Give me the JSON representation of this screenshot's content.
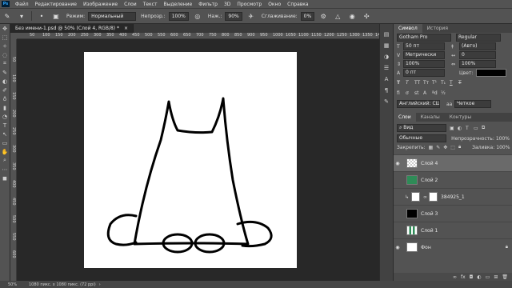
{
  "menu": [
    "Файл",
    "Редактирование",
    "Изображение",
    "Слои",
    "Текст",
    "Выделение",
    "Фильтр",
    "3D",
    "Просмотр",
    "Окно",
    "Справка"
  ],
  "options": {
    "mode_label": "Режим:",
    "mode_value": "Нормальный",
    "opacity_label": "Непрозр.:",
    "opacity_value": "100%",
    "pressure_label": "Наж.:",
    "pressure_value": "90%",
    "smoothing_label": "Сглаживание:",
    "smoothing_value": "0%"
  },
  "tools": [
    "✥",
    "⬚",
    "✧",
    "◌",
    "⌗",
    "✎",
    "◐",
    "✐",
    "♁",
    "▮",
    "◔",
    "T",
    "↖",
    "▭",
    "✋",
    "⌕",
    "⋯",
    "◼"
  ],
  "document": {
    "tab_title": "Без имени-1.psd @ 50% (Слой 4, RGB/8) *",
    "ruler_ticks": [
      "50",
      "100",
      "150",
      "200",
      "250",
      "300",
      "350",
      "400",
      "450",
      "500",
      "550",
      "600",
      "650",
      "700",
      "750",
      "800",
      "850",
      "900",
      "950",
      "1000",
      "1050",
      "1100",
      "1150",
      "1200",
      "1250",
      "1300",
      "1350",
      "1400"
    ],
    "ruler_left_ticks": [
      "50",
      "100",
      "150",
      "200",
      "250",
      "300",
      "350",
      "400",
      "450",
      "500",
      "550",
      "600"
    ]
  },
  "status": {
    "zoom": "50%",
    "doc_info": "1080 пикс. x 1080 пикс. (72 ppi)"
  },
  "char_panel": {
    "tabs": [
      "Символ",
      "История"
    ],
    "font_family": "Gotham Pro",
    "font_style": "Regular",
    "size": "50 пт",
    "leading": "(Авто)",
    "kerning": "Метрически",
    "tracking": "0",
    "v_scale": "100%",
    "h_scale": "100%",
    "baseline": "0 пт",
    "color_label": "Цвет:",
    "language": "Английский: США",
    "antialias": "Четкое"
  },
  "layers_panel": {
    "tabs": [
      "Слои",
      "Каналы",
      "Контуры"
    ],
    "filter_label": "Вид",
    "blend_mode": "Обычные",
    "opacity_label": "Непрозрачность:",
    "opacity_value": "100%",
    "lock_label": "Закрепить:",
    "fill_label": "Заливка:",
    "fill_value": "100%",
    "layers": [
      {
        "name": "Слой 4",
        "visible": true,
        "selected": true
      },
      {
        "name": "Слой 2",
        "visible": false,
        "selected": false
      },
      {
        "name": "384925_1",
        "visible": false,
        "selected": false
      },
      {
        "name": "Слой 3",
        "visible": false,
        "selected": false
      },
      {
        "name": "Слой 1",
        "visible": false,
        "selected": false
      },
      {
        "name": "Фон",
        "visible": true,
        "selected": false
      }
    ]
  }
}
